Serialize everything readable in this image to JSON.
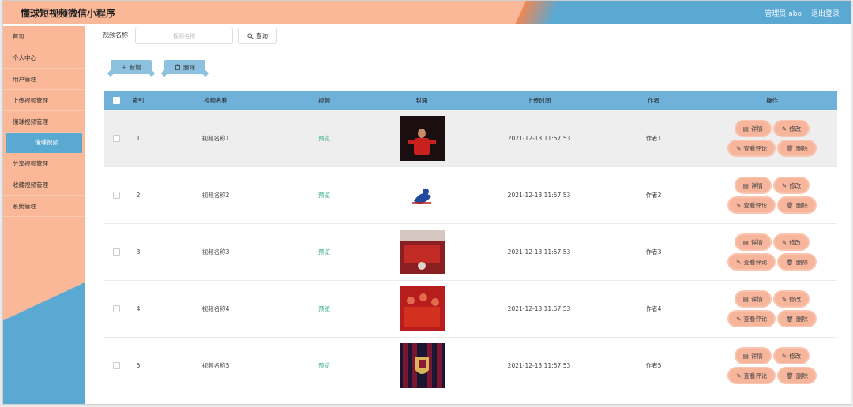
{
  "header": {
    "title": "懂球短视频微信小程序",
    "admin": "管理员 abo",
    "logout": "退出登录"
  },
  "sidebar": {
    "items": [
      {
        "label": "首页",
        "chevron": false
      },
      {
        "label": "个人中心",
        "chevron": true
      },
      {
        "label": "用户管理",
        "chevron": true
      },
      {
        "label": "上传视频管理",
        "chevron": true
      },
      {
        "label": "懂球视频管理",
        "chevron": true
      },
      {
        "label": "懂球视频",
        "chevron": false,
        "sub": true
      },
      {
        "label": "分享视频管理",
        "chevron": true
      },
      {
        "label": "收藏视频管理",
        "chevron": true
      },
      {
        "label": "系统管理",
        "chevron": true
      }
    ]
  },
  "search": {
    "label": "视频名称",
    "placeholder": "视频名称",
    "button": "查询"
  },
  "toolbar": {
    "add": "新增",
    "delete": "删除"
  },
  "table": {
    "headers": [
      "索引",
      "视频名称",
      "视频",
      "封面",
      "上传时间",
      "作者",
      "操作"
    ],
    "rows": [
      {
        "idx": "1",
        "name": "视频名称1",
        "video": "预览",
        "time": "2021-12-13 11:57:53",
        "author": "作者1"
      },
      {
        "idx": "2",
        "name": "视频名称2",
        "video": "预览",
        "time": "2021-12-13 11:57:53",
        "author": "作者2"
      },
      {
        "idx": "3",
        "name": "视频名称3",
        "video": "预览",
        "time": "2021-12-13 11:57:53",
        "author": "作者3"
      },
      {
        "idx": "4",
        "name": "视频名称4",
        "video": "预览",
        "time": "2021-12-13 11:57:53",
        "author": "作者4"
      },
      {
        "idx": "5",
        "name": "视频名称5",
        "video": "预览",
        "time": "2021-12-13 11:57:53",
        "author": "作者5"
      }
    ],
    "ops": {
      "detail": "详情",
      "edit": "修改",
      "comments": "查看评论",
      "delete": "删除"
    }
  },
  "colors": {
    "accent_blue": "#6fb1d8",
    "accent_salmon": "#fbb898",
    "preview_green": "#3bb08f"
  }
}
